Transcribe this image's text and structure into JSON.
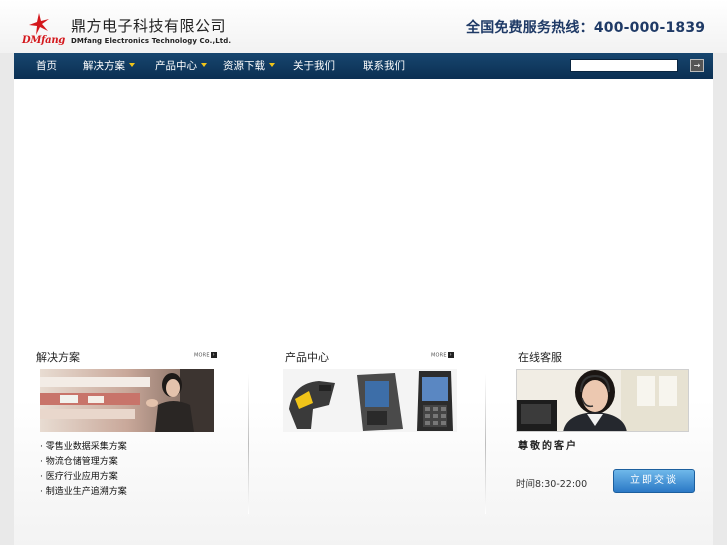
{
  "header": {
    "logo_text": "DMfang",
    "company_cn": "鼎方电子科技有限公司",
    "company_en": "DMfang Electronics Technology Co.,Ltd.",
    "hotline_label": "全国免费服务热线：",
    "hotline_number": "400-000-1839"
  },
  "nav": {
    "items": [
      {
        "label": "首页",
        "dropdown": false
      },
      {
        "label": "解决方案",
        "dropdown": true
      },
      {
        "label": "产品中心",
        "dropdown": true
      },
      {
        "label": "资源下载",
        "dropdown": true
      },
      {
        "label": "关于我们",
        "dropdown": false
      },
      {
        "label": "联系我们",
        "dropdown": false
      }
    ],
    "search_value": "",
    "search_button": "→"
  },
  "solutions": {
    "title": "解决方案",
    "more": "MORE",
    "items": [
      "· 零售业数据采集方案",
      "· 物流仓储管理方案",
      "· 医疗行业应用方案",
      "· 制造业生产追溯方案"
    ]
  },
  "products": {
    "title": "产品中心",
    "more": "MORE"
  },
  "service": {
    "title": "在线客服",
    "greeting": "尊敬的客户",
    "hours": "时间8:30-22:00",
    "chat_button": "立即交谈"
  },
  "colors": {
    "nav_bg": "#0b2f52",
    "brand_red": "#d4171c",
    "hotline_blue": "#1f3a66",
    "chat_button": "#2b79c6"
  }
}
